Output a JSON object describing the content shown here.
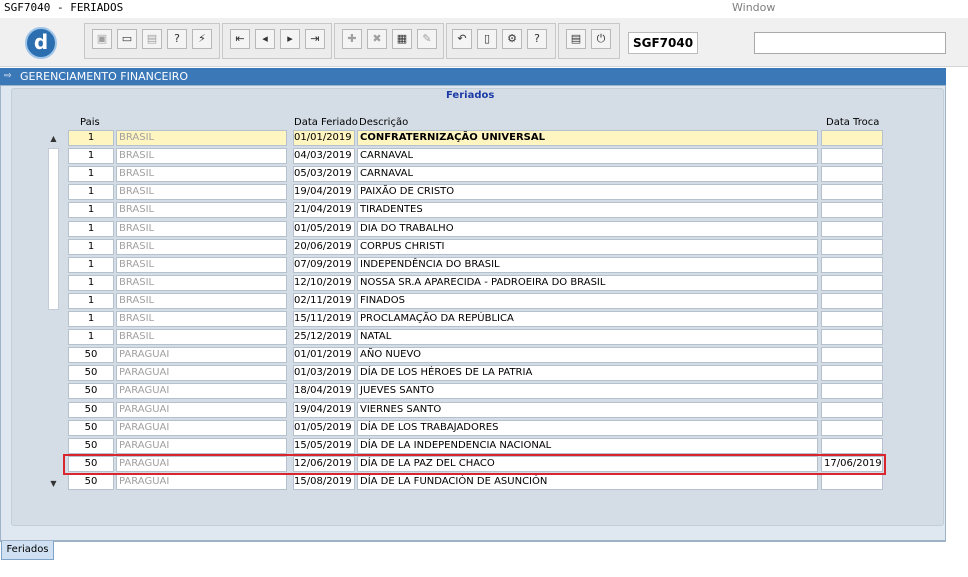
{
  "window": {
    "title": "SGF7040 - FERIADOS",
    "label": "Window"
  },
  "toolbar": {
    "form_code": "SGF7040",
    "buttons": [
      {
        "name": "save-icon",
        "glyph": "▣"
      },
      {
        "name": "print-preview-icon",
        "glyph": "▭"
      },
      {
        "name": "print-icon",
        "glyph": "▤"
      },
      {
        "name": "query-help-icon",
        "glyph": "?"
      },
      {
        "name": "execute-query-icon",
        "glyph": "⚡"
      },
      {
        "name": "first-record-icon",
        "glyph": "⇤"
      },
      {
        "name": "previous-record-icon",
        "glyph": "◂"
      },
      {
        "name": "next-record-icon",
        "glyph": "▸"
      },
      {
        "name": "last-record-icon",
        "glyph": "⇥"
      },
      {
        "name": "insert-record-icon",
        "glyph": "✚"
      },
      {
        "name": "delete-record-icon",
        "glyph": "✖"
      },
      {
        "name": "clear-record-icon",
        "glyph": "▦"
      },
      {
        "name": "edit-icon",
        "glyph": "✎"
      },
      {
        "name": "undo-icon",
        "glyph": "↶"
      },
      {
        "name": "clipboard-icon",
        "glyph": "▯"
      },
      {
        "name": "tools-icon",
        "glyph": "⚙"
      },
      {
        "name": "help-icon",
        "glyph": "?"
      },
      {
        "name": "menu-icon",
        "glyph": "▤"
      },
      {
        "name": "exit-icon",
        "glyph": "⏻"
      }
    ],
    "search_value": ""
  },
  "section": {
    "title": "GERENCIAMENTO FINANCEIRO"
  },
  "block": {
    "title": "Feriados"
  },
  "columns": {
    "pais": "Pais",
    "data": "Data Feriado",
    "descricao": "Descrição",
    "troca": "Data Troca"
  },
  "rows": [
    {
      "pais": "1",
      "nome": "BRASIL",
      "data": "01/01/2019",
      "descricao": "CONFRATERNIZAÇÃO UNIVERSAL",
      "troca": ""
    },
    {
      "pais": "1",
      "nome": "BRASIL",
      "data": "04/03/2019",
      "descricao": "CARNAVAL",
      "troca": ""
    },
    {
      "pais": "1",
      "nome": "BRASIL",
      "data": "05/03/2019",
      "descricao": "CARNAVAL",
      "troca": ""
    },
    {
      "pais": "1",
      "nome": "BRASIL",
      "data": "19/04/2019",
      "descricao": "PAIXÃO DE CRISTO",
      "troca": ""
    },
    {
      "pais": "1",
      "nome": "BRASIL",
      "data": "21/04/2019",
      "descricao": "TIRADENTES",
      "troca": ""
    },
    {
      "pais": "1",
      "nome": "BRASIL",
      "data": "01/05/2019",
      "descricao": "DIA DO TRABALHO",
      "troca": ""
    },
    {
      "pais": "1",
      "nome": "BRASIL",
      "data": "20/06/2019",
      "descricao": "CORPUS CHRISTI",
      "troca": ""
    },
    {
      "pais": "1",
      "nome": "BRASIL",
      "data": "07/09/2019",
      "descricao": "INDEPENDÊNCIA DO BRASIL",
      "troca": ""
    },
    {
      "pais": "1",
      "nome": "BRASIL",
      "data": "12/10/2019",
      "descricao": "NOSSA SR.A APARECIDA - PADROEIRA DO BRASIL",
      "troca": ""
    },
    {
      "pais": "1",
      "nome": "BRASIL",
      "data": "02/11/2019",
      "descricao": "FINADOS",
      "troca": ""
    },
    {
      "pais": "1",
      "nome": "BRASIL",
      "data": "15/11/2019",
      "descricao": "PROCLAMAÇÃO DA REPÚBLICA",
      "troca": ""
    },
    {
      "pais": "1",
      "nome": "BRASIL",
      "data": "25/12/2019",
      "descricao": "NATAL",
      "troca": ""
    },
    {
      "pais": "50",
      "nome": "PARAGUAI",
      "data": "01/01/2019",
      "descricao": "AÑO NUEVO",
      "troca": ""
    },
    {
      "pais": "50",
      "nome": "PARAGUAI",
      "data": "01/03/2019",
      "descricao": "DÍA DE LOS HÉROES DE LA PATRIA",
      "troca": ""
    },
    {
      "pais": "50",
      "nome": "PARAGUAI",
      "data": "18/04/2019",
      "descricao": "JUEVES SANTO",
      "troca": ""
    },
    {
      "pais": "50",
      "nome": "PARAGUAI",
      "data": "19/04/2019",
      "descricao": "VIERNES SANTO",
      "troca": ""
    },
    {
      "pais": "50",
      "nome": "PARAGUAI",
      "data": "01/05/2019",
      "descricao": "DÍA DE LOS TRABAJADORES",
      "troca": ""
    },
    {
      "pais": "50",
      "nome": "PARAGUAI",
      "data": "15/05/2019",
      "descricao": "DÍA DE LA INDEPENDENCIA NACIONAL",
      "troca": ""
    },
    {
      "pais": "50",
      "nome": "PARAGUAI",
      "data": "12/06/2019",
      "descricao": "DÍA DE LA PAZ DEL CHACO",
      "troca": "17/06/2019"
    },
    {
      "pais": "50",
      "nome": "PARAGUAI",
      "data": "15/08/2019",
      "descricao": "DÍA DE LA FUNDACIÓN DE ASUNCIÓN",
      "troca": ""
    }
  ],
  "tab": {
    "label": "Feriados"
  },
  "colors": {
    "accent": "#3b78b8",
    "current_row": "#fff5c0",
    "highlight": "#d9252d",
    "block_title": "#1c3aa6"
  }
}
